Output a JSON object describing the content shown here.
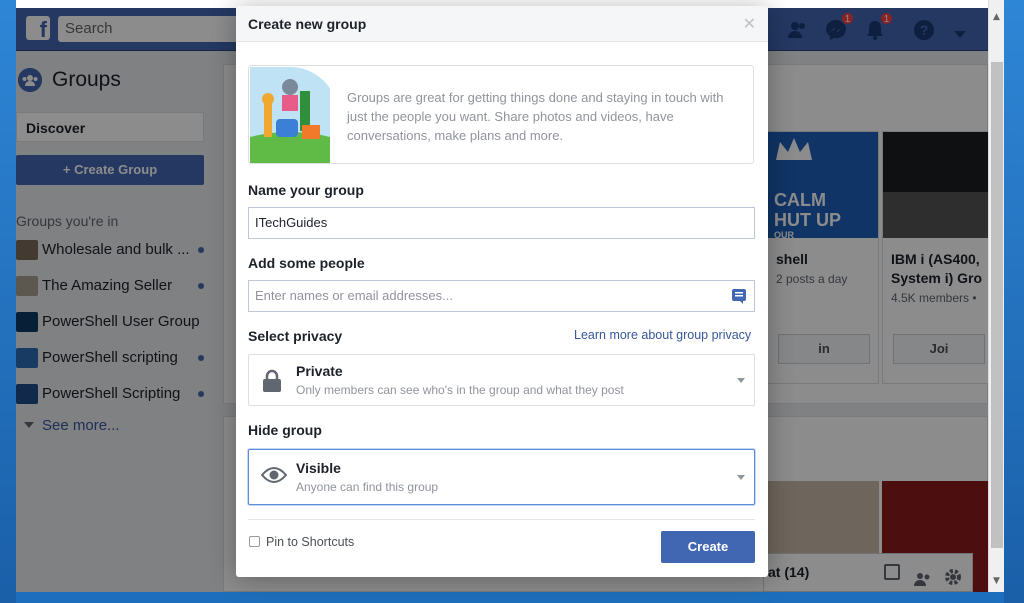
{
  "header": {
    "search_placeholder": "Search",
    "messages_badge": "1",
    "notifications_badge": "1"
  },
  "sidebar": {
    "title": "Groups",
    "discover_label": "Discover",
    "create_group_label": "+ Create Group",
    "section_label": "Groups you're in",
    "items": [
      {
        "label": "Wholesale and bulk ..."
      },
      {
        "label": "The Amazing Seller"
      },
      {
        "label": "PowerShell User Group"
      },
      {
        "label": "PowerShell scripting"
      },
      {
        "label": "PowerShell Scripting"
      }
    ],
    "see_more_label": "See more..."
  },
  "background": {
    "card1": {
      "banner_line1": "CALM",
      "banner_line2": "HUT UP",
      "banner_line3": "OUR",
      "title": "shell",
      "subtitle": "2 posts a day",
      "button": "in"
    },
    "card2": {
      "title_line1": "IBM i (AS400,",
      "title_line2": "System i) Gro",
      "subtitle": "4.5K members •",
      "button": "Joi"
    },
    "chat_label": "at (14)"
  },
  "modal": {
    "title": "Create new group",
    "close_glyph": "✕",
    "intro_text": "Groups are great for getting things done and staying in touch with just the people you want. Share photos and videos, have conversations, make plans and more.",
    "name_label": "Name your group",
    "name_value": "ITechGuides",
    "people_label": "Add some people",
    "people_placeholder": "Enter names or email addresses...",
    "privacy_label": "Select privacy",
    "privacy_link": "Learn more about group privacy",
    "privacy_title": "Private",
    "privacy_desc": "Only members can see who's in the group and what they post",
    "hide_label": "Hide group",
    "hide_title": "Visible",
    "hide_desc": "Anyone can find this group",
    "pin_label": "Pin to Shortcuts",
    "create_label": "Create"
  },
  "colors": {
    "brand": "#4267b2",
    "link": "#365899",
    "badge": "#fa3e3e"
  }
}
